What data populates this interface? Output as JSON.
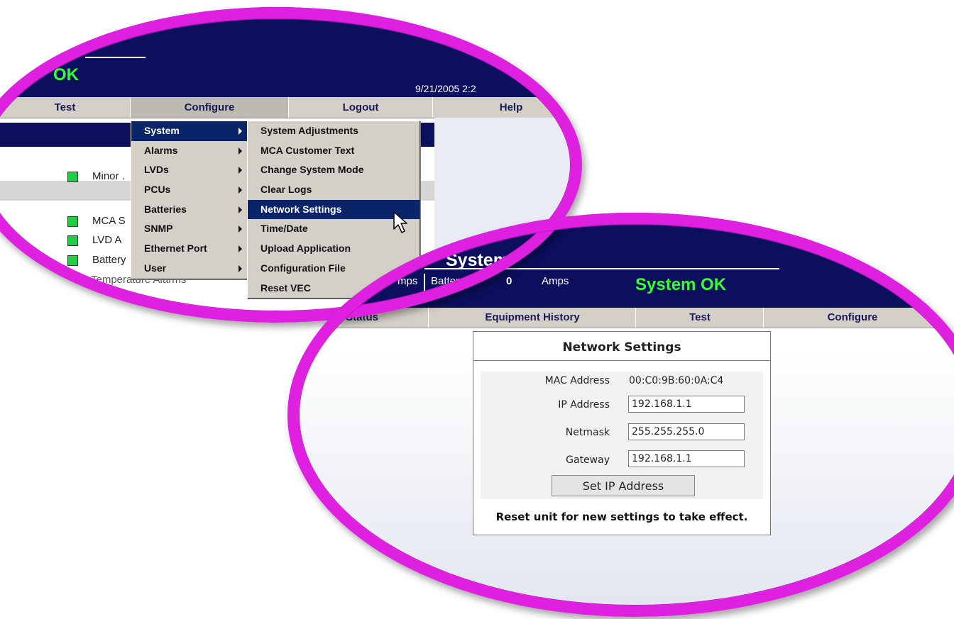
{
  "colors": {
    "ring": "#e020e0",
    "header": "#0b0f5e",
    "status_ok": "#33ff33",
    "menu_bg": "#d4d0c8",
    "menu_highlight": "#0a246a",
    "alarm_ok": "#22cc44"
  },
  "top": {
    "status": "OK",
    "datetime": "9/21/2005 2:2",
    "nav": [
      "Test",
      "Configure",
      "Logout",
      "Help"
    ],
    "alarms": [
      "Minor .",
      "MCA S",
      "LVD A",
      "Battery",
      "Temperature Alarms"
    ],
    "configure_menu": [
      {
        "label": "System",
        "submenu": true,
        "highlighted": true
      },
      {
        "label": "Alarms",
        "submenu": true
      },
      {
        "label": "LVDs",
        "submenu": true
      },
      {
        "label": "PCUs",
        "submenu": true
      },
      {
        "label": "Batteries",
        "submenu": true
      },
      {
        "label": "SNMP",
        "submenu": true
      },
      {
        "label": "Ethernet Port",
        "submenu": true
      },
      {
        "label": "User",
        "submenu": true
      }
    ],
    "system_submenu": [
      {
        "label": "System Adjustments"
      },
      {
        "label": "MCA Customer Text"
      },
      {
        "label": "Change System Mode"
      },
      {
        "label": "Clear Logs"
      },
      {
        "label": "Network Settings",
        "highlighted": true
      },
      {
        "label": "Time/Date"
      },
      {
        "label": "Upload Application"
      },
      {
        "label": "Configuration File"
      },
      {
        "label": "Reset VEC"
      }
    ],
    "cursor_icon": "arrow-pointer-icon"
  },
  "bottom": {
    "title": "System",
    "load_unit": "mps",
    "battery_label": "Battery:",
    "battery_value": "0",
    "battery_unit": "Amps",
    "status": "System OK",
    "nav": [
      "Status",
      "Equipment History",
      "Test",
      "Configure"
    ],
    "network_settings": {
      "title": "Network Settings",
      "mac_label": "MAC Address",
      "mac_value": "00:C0:9B:60:0A:C4",
      "ip_label": "IP Address",
      "ip_value": "192.168.1.1",
      "netmask_label": "Netmask",
      "netmask_value": "255.255.255.0",
      "gateway_label": "Gateway",
      "gateway_value": "192.168.1.1",
      "button_label": "Set IP Address",
      "note": "Reset unit for new settings to take effect."
    }
  }
}
